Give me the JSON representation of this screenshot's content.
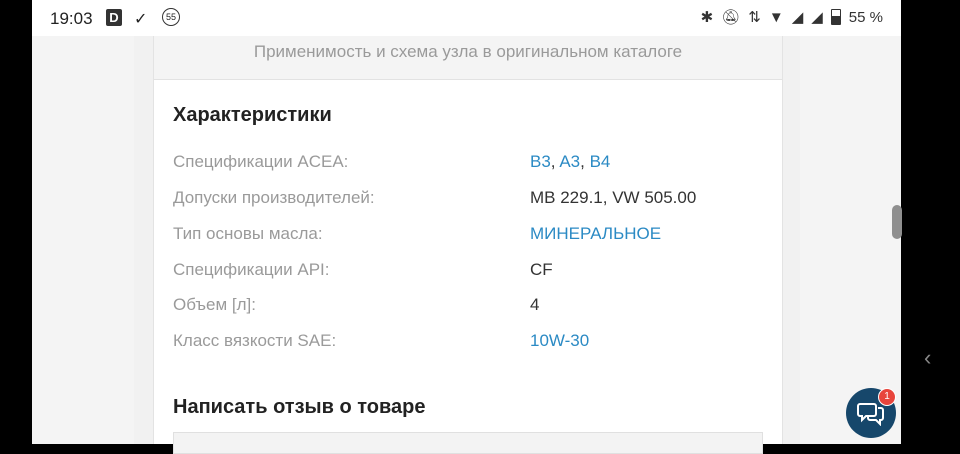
{
  "status_bar": {
    "time": "19:03",
    "icons_left": [
      "d-app-icon",
      "download-check-icon",
      "badge-55-icon"
    ],
    "badge_text": "55",
    "battery": "55 %"
  },
  "catalog": {
    "link_text": "Применимость и схема узла в оригинальном каталоге"
  },
  "characteristics": {
    "title": "Характеристики",
    "rows": [
      {
        "label": "Спецификации ACEA:",
        "links": [
          "B3",
          "A3",
          "B4"
        ]
      },
      {
        "label": "Допуски производителей:",
        "value": "MB 229.1, VW 505.00"
      },
      {
        "label": "Тип основы масла:",
        "link": "МИНЕРАЛЬНОЕ"
      },
      {
        "label": "Спецификации API:",
        "value": "CF"
      },
      {
        "label": "Объем [л]:",
        "value": "4"
      },
      {
        "label": "Класс вязкости SAE:",
        "link": "10W-30"
      }
    ]
  },
  "review": {
    "title": "Написать отзыв о товаре"
  },
  "chat": {
    "badge_count": "1"
  },
  "colors": {
    "link": "#2b8ac4",
    "chat_button": "#16476b",
    "badge": "#e8453c"
  }
}
